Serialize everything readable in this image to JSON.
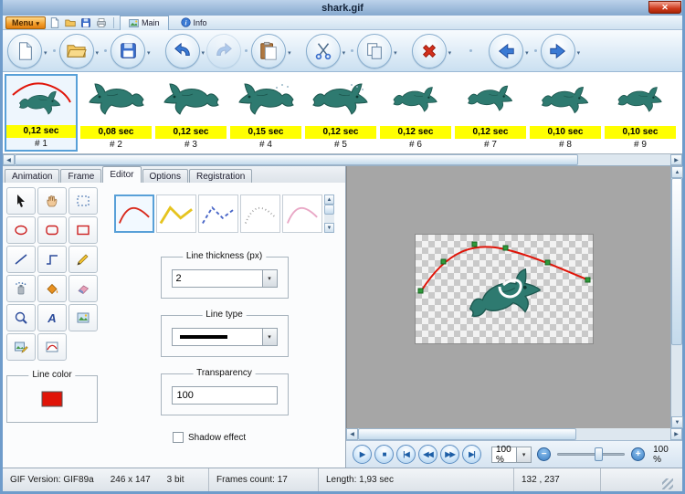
{
  "window": {
    "title": "shark.gif"
  },
  "menubar": {
    "menu_label": "Menu",
    "tabs": [
      {
        "label": "Main",
        "active": true
      },
      {
        "label": "Info",
        "active": false
      }
    ]
  },
  "toolbar": {
    "buttons": [
      {
        "name": "new"
      },
      {
        "name": "open"
      },
      {
        "name": "save"
      },
      {
        "name": "undo"
      },
      {
        "name": "redo",
        "disabled": true
      },
      {
        "name": "paste"
      },
      {
        "name": "cut"
      },
      {
        "name": "copy"
      },
      {
        "name": "delete"
      },
      {
        "name": "back"
      },
      {
        "name": "forward"
      }
    ]
  },
  "frames": [
    {
      "duration": "0,12 sec",
      "label": "# 1",
      "selected": true
    },
    {
      "duration": "0,08 sec",
      "label": "# 2"
    },
    {
      "duration": "0,12 sec",
      "label": "# 3"
    },
    {
      "duration": "0,15 sec",
      "label": "# 4"
    },
    {
      "duration": "0,12 sec",
      "label": "# 5"
    },
    {
      "duration": "0,12 sec",
      "label": "# 6"
    },
    {
      "duration": "0,12 sec",
      "label": "# 7"
    },
    {
      "duration": "0,10 sec",
      "label": "# 8"
    },
    {
      "duration": "0,10 sec",
      "label": "# 9"
    }
  ],
  "panel": {
    "tabs": [
      {
        "label": "Animation"
      },
      {
        "label": "Frame"
      },
      {
        "label": "Editor",
        "active": true
      },
      {
        "label": "Options"
      },
      {
        "label": "Registration"
      }
    ],
    "line_color_label": "Line color",
    "groups": {
      "thickness_label": "Line thickness (px)",
      "thickness_value": "2",
      "line_type_label": "Line type",
      "transparency_label": "Transparency",
      "transparency_value": "100",
      "shadow_label": "Shadow effect"
    },
    "line_styles": [
      {
        "name": "solid-curve",
        "color": "#d92b1e",
        "selected": true
      },
      {
        "name": "solid-polyline",
        "color": "#e6c41f"
      },
      {
        "name": "dashed-polyline",
        "color": "#4a67c8"
      },
      {
        "name": "dotted-curve",
        "color": "#9a9a9a"
      },
      {
        "name": "soft-curve",
        "color": "#e9a8c6"
      }
    ]
  },
  "playback": {
    "buttons": [
      {
        "name": "play",
        "glyph": "▶"
      },
      {
        "name": "stop",
        "glyph": "■"
      },
      {
        "name": "first-frame",
        "glyph": "|◀"
      },
      {
        "name": "previous-frame",
        "glyph": "◀◀"
      },
      {
        "name": "next-frame",
        "glyph": "▶▶"
      },
      {
        "name": "last-frame",
        "glyph": "▶|"
      }
    ],
    "zoom_select": "100 %",
    "zoom_label": "100 %"
  },
  "statusbar": {
    "gif_version": "GIF Version: GIF89a",
    "size": "246 x 147",
    "bits": "3 bit",
    "frames_count": "Frames count: 17",
    "length": "Length: 1,93 sec",
    "coords": "132 , 237"
  },
  "colors": {
    "frame_label_bg": "#ffff00",
    "selection": "#58a0d8",
    "line_color": "#e01408",
    "canvas_bg": "#a6a6a6"
  }
}
